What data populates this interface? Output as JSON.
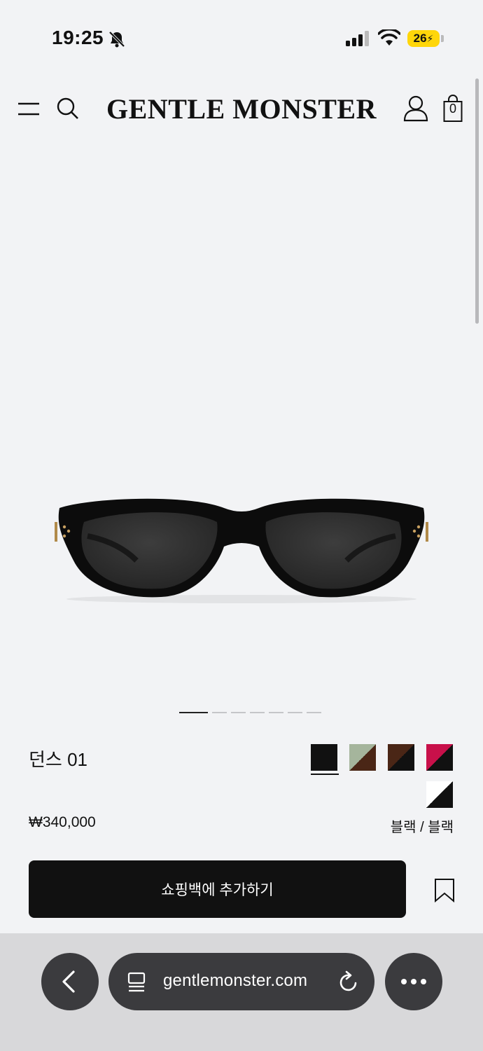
{
  "status_bar": {
    "time": "19:25",
    "battery": "26",
    "icons": [
      "bell-slash-icon",
      "cellular-signal-icon",
      "wifi-icon",
      "battery-charging-icon"
    ]
  },
  "header": {
    "brand": "GENTLE MONSTER",
    "bag_count": "0",
    "icons": [
      "menu-icon",
      "search-icon",
      "user-icon",
      "shopping-bag-icon"
    ]
  },
  "carousel": {
    "total_images": 7,
    "active_index": 0
  },
  "product": {
    "name": "던스 01",
    "price": "₩340,000",
    "selected_color": "블랙 / 블랙",
    "swatches": [
      {
        "colors": [
          "#111111",
          "#111111"
        ],
        "selected": true
      },
      {
        "colors": [
          "#a5b59c",
          "#4a2616"
        ],
        "selected": false
      },
      {
        "colors": [
          "#4a2616",
          "#111111"
        ],
        "selected": false
      },
      {
        "colors": [
          "#c8104a",
          "#111111"
        ],
        "selected": false
      },
      {
        "colors": [
          "#ffffff",
          "#111111"
        ],
        "selected": false
      }
    ],
    "add_to_bag_label": "쇼핑백에 추가하기"
  },
  "browser": {
    "url": "gentlemonster.com",
    "icons": [
      "back-icon",
      "tabs-icon",
      "reload-icon",
      "more-icon"
    ]
  }
}
